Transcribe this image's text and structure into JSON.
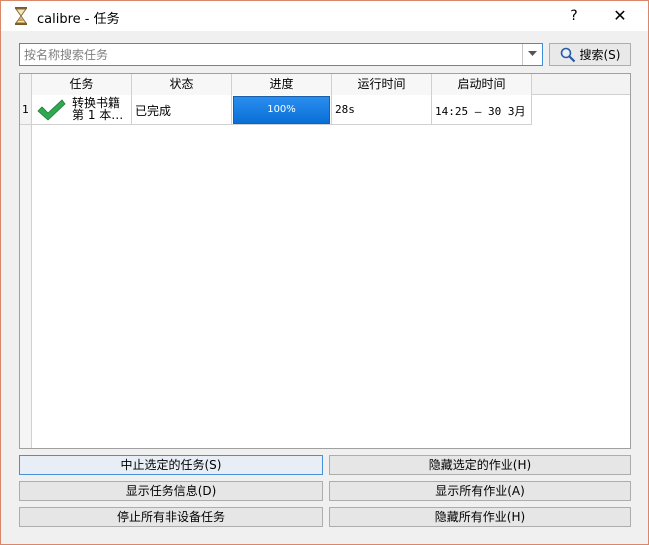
{
  "window": {
    "title": "calibre - 任务",
    "help_glyph": "?",
    "close_glyph": "✕"
  },
  "search": {
    "placeholder": "按名称搜索任务",
    "button_label": "搜索(S)"
  },
  "table": {
    "headers": [
      "任务",
      "状态",
      "进度",
      "运行时间",
      "启动时间"
    ],
    "rows": [
      {
        "index": "1",
        "job_line1": "转换书籍",
        "job_line2": "第 1 本…",
        "status": "已完成",
        "progress_label": "100%",
        "progress_value": 100,
        "run_time": "28s",
        "start_time": "14:25 — 30 3月"
      }
    ]
  },
  "buttons": {
    "abort_selected": "中止选定的任务(S)",
    "hide_selected": "隐藏选定的作业(H)",
    "show_job_details": "显示任务信息(D)",
    "show_all": "显示所有作业(A)",
    "stop_all_non_device": "停止所有非设备任务",
    "hide_all": "隐藏所有作业(H)"
  },
  "colors": {
    "accent": "#0f7ae5",
    "check_green": "#2fa84f",
    "window_border": "#d9876a"
  }
}
